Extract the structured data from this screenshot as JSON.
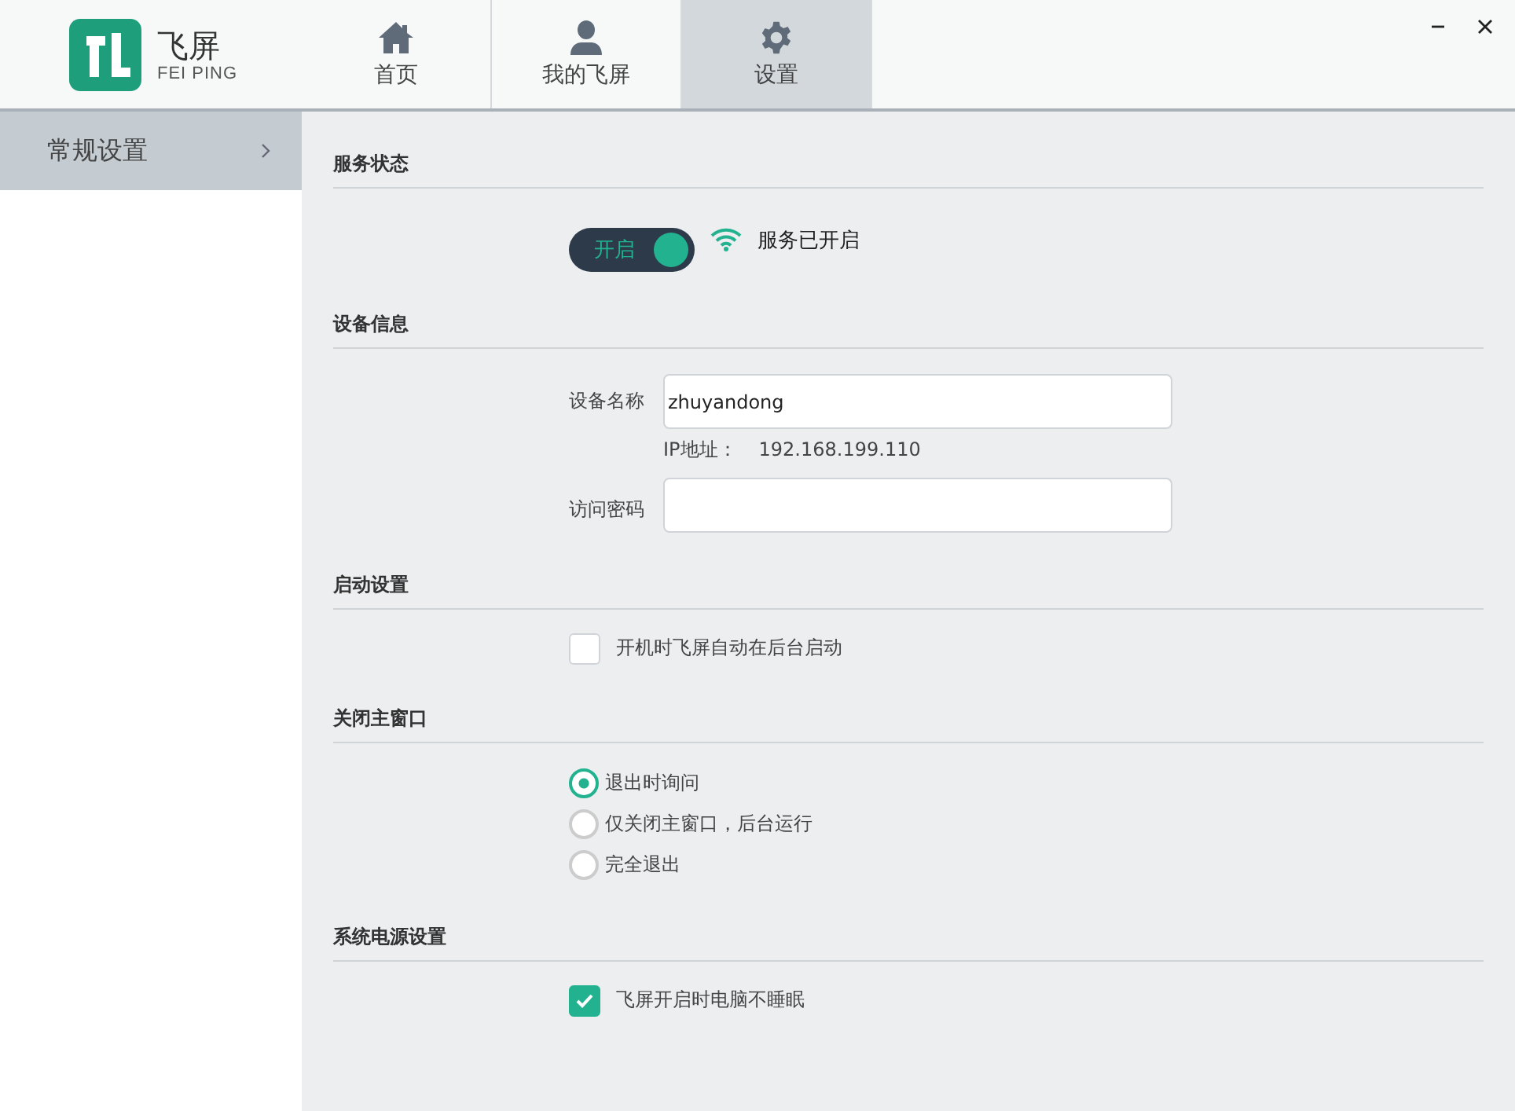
{
  "logo": {
    "title": "飞屏",
    "subtitle": "FEI PING"
  },
  "tabs": [
    {
      "label": "首页",
      "selected": false
    },
    {
      "label": "我的飞屏",
      "selected": false
    },
    {
      "label": "设置",
      "selected": true
    }
  ],
  "sidebar": {
    "items": [
      {
        "label": "常规设置",
        "selected": true
      }
    ]
  },
  "sections": [
    {
      "title": "服务状态",
      "items": [
        {
          "kind": "toggle",
          "label": "开启",
          "on": true,
          "status": "服务已开启"
        }
      ]
    },
    {
      "title": "设备信息",
      "items": [
        {
          "kind": "field",
          "label": "设备名称",
          "value": "zhuyandong"
        },
        {
          "kind": "note",
          "label": "IP地址：",
          "value": "192.168.199.110"
        },
        {
          "kind": "field",
          "label": "访问密码"
        }
      ]
    },
    {
      "title": "启动设置",
      "items": [
        {
          "kind": "checkbox",
          "label": "开机时飞屏自动在后台启动",
          "checked": false
        }
      ]
    },
    {
      "title": "关闭主窗口",
      "items": [
        {
          "kind": "radio",
          "label": "退出时询问",
          "selected": true
        },
        {
          "kind": "radio",
          "label": "仅关闭主窗口，后台运行",
          "selected": false
        },
        {
          "kind": "radio",
          "label": "完全退出",
          "selected": false
        }
      ]
    },
    {
      "title": "系统电源设置",
      "items": [
        {
          "kind": "checkbox",
          "label": "飞屏开启时电脑不睡眠",
          "checked": true
        }
      ]
    }
  ]
}
